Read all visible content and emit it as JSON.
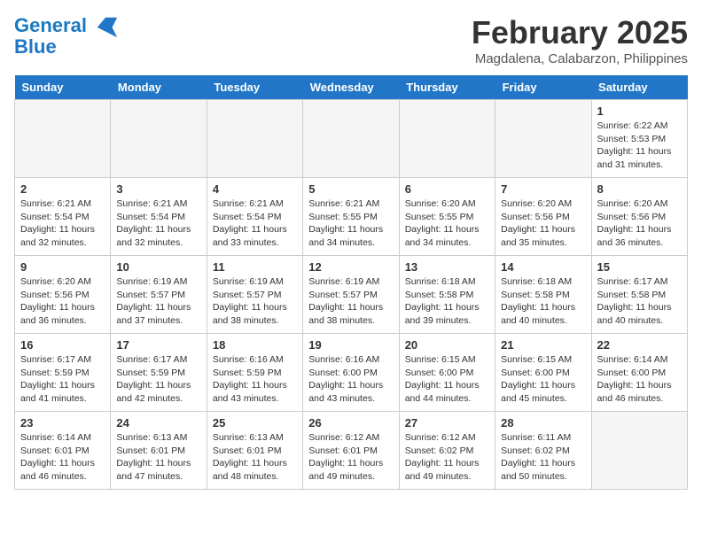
{
  "header": {
    "logo_line1": "General",
    "logo_line2": "Blue",
    "month_title": "February 2025",
    "location": "Magdalena, Calabarzon, Philippines"
  },
  "weekdays": [
    "Sunday",
    "Monday",
    "Tuesday",
    "Wednesday",
    "Thursday",
    "Friday",
    "Saturday"
  ],
  "weeks": [
    [
      {
        "day": "",
        "info": ""
      },
      {
        "day": "",
        "info": ""
      },
      {
        "day": "",
        "info": ""
      },
      {
        "day": "",
        "info": ""
      },
      {
        "day": "",
        "info": ""
      },
      {
        "day": "",
        "info": ""
      },
      {
        "day": "1",
        "info": "Sunrise: 6:22 AM\nSunset: 5:53 PM\nDaylight: 11 hours\nand 31 minutes."
      }
    ],
    [
      {
        "day": "2",
        "info": "Sunrise: 6:21 AM\nSunset: 5:54 PM\nDaylight: 11 hours\nand 32 minutes."
      },
      {
        "day": "3",
        "info": "Sunrise: 6:21 AM\nSunset: 5:54 PM\nDaylight: 11 hours\nand 32 minutes."
      },
      {
        "day": "4",
        "info": "Sunrise: 6:21 AM\nSunset: 5:54 PM\nDaylight: 11 hours\nand 33 minutes."
      },
      {
        "day": "5",
        "info": "Sunrise: 6:21 AM\nSunset: 5:55 PM\nDaylight: 11 hours\nand 34 minutes."
      },
      {
        "day": "6",
        "info": "Sunrise: 6:20 AM\nSunset: 5:55 PM\nDaylight: 11 hours\nand 34 minutes."
      },
      {
        "day": "7",
        "info": "Sunrise: 6:20 AM\nSunset: 5:56 PM\nDaylight: 11 hours\nand 35 minutes."
      },
      {
        "day": "8",
        "info": "Sunrise: 6:20 AM\nSunset: 5:56 PM\nDaylight: 11 hours\nand 36 minutes."
      }
    ],
    [
      {
        "day": "9",
        "info": "Sunrise: 6:20 AM\nSunset: 5:56 PM\nDaylight: 11 hours\nand 36 minutes."
      },
      {
        "day": "10",
        "info": "Sunrise: 6:19 AM\nSunset: 5:57 PM\nDaylight: 11 hours\nand 37 minutes."
      },
      {
        "day": "11",
        "info": "Sunrise: 6:19 AM\nSunset: 5:57 PM\nDaylight: 11 hours\nand 38 minutes."
      },
      {
        "day": "12",
        "info": "Sunrise: 6:19 AM\nSunset: 5:57 PM\nDaylight: 11 hours\nand 38 minutes."
      },
      {
        "day": "13",
        "info": "Sunrise: 6:18 AM\nSunset: 5:58 PM\nDaylight: 11 hours\nand 39 minutes."
      },
      {
        "day": "14",
        "info": "Sunrise: 6:18 AM\nSunset: 5:58 PM\nDaylight: 11 hours\nand 40 minutes."
      },
      {
        "day": "15",
        "info": "Sunrise: 6:17 AM\nSunset: 5:58 PM\nDaylight: 11 hours\nand 40 minutes."
      }
    ],
    [
      {
        "day": "16",
        "info": "Sunrise: 6:17 AM\nSunset: 5:59 PM\nDaylight: 11 hours\nand 41 minutes."
      },
      {
        "day": "17",
        "info": "Sunrise: 6:17 AM\nSunset: 5:59 PM\nDaylight: 11 hours\nand 42 minutes."
      },
      {
        "day": "18",
        "info": "Sunrise: 6:16 AM\nSunset: 5:59 PM\nDaylight: 11 hours\nand 43 minutes."
      },
      {
        "day": "19",
        "info": "Sunrise: 6:16 AM\nSunset: 6:00 PM\nDaylight: 11 hours\nand 43 minutes."
      },
      {
        "day": "20",
        "info": "Sunrise: 6:15 AM\nSunset: 6:00 PM\nDaylight: 11 hours\nand 44 minutes."
      },
      {
        "day": "21",
        "info": "Sunrise: 6:15 AM\nSunset: 6:00 PM\nDaylight: 11 hours\nand 45 minutes."
      },
      {
        "day": "22",
        "info": "Sunrise: 6:14 AM\nSunset: 6:00 PM\nDaylight: 11 hours\nand 46 minutes."
      }
    ],
    [
      {
        "day": "23",
        "info": "Sunrise: 6:14 AM\nSunset: 6:01 PM\nDaylight: 11 hours\nand 46 minutes."
      },
      {
        "day": "24",
        "info": "Sunrise: 6:13 AM\nSunset: 6:01 PM\nDaylight: 11 hours\nand 47 minutes."
      },
      {
        "day": "25",
        "info": "Sunrise: 6:13 AM\nSunset: 6:01 PM\nDaylight: 11 hours\nand 48 minutes."
      },
      {
        "day": "26",
        "info": "Sunrise: 6:12 AM\nSunset: 6:01 PM\nDaylight: 11 hours\nand 49 minutes."
      },
      {
        "day": "27",
        "info": "Sunrise: 6:12 AM\nSunset: 6:02 PM\nDaylight: 11 hours\nand 49 minutes."
      },
      {
        "day": "28",
        "info": "Sunrise: 6:11 AM\nSunset: 6:02 PM\nDaylight: 11 hours\nand 50 minutes."
      },
      {
        "day": "",
        "info": ""
      }
    ]
  ]
}
